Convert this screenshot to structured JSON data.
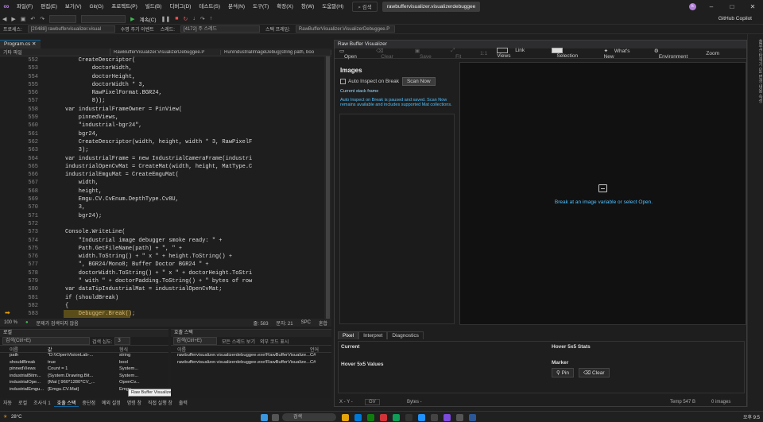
{
  "menu": [
    "파일(F)",
    "편집(E)",
    "보기(V)",
    "Git(G)",
    "프로젝트(P)",
    "빌드(B)",
    "디버그(D)",
    "테스트(S)",
    "분석(N)",
    "도구(T)",
    "확장(X)",
    "창(W)",
    "도움말(H)"
  ],
  "search_label": "검색",
  "solution_title": "rawbuffervisualizer.visualizerdebuggee",
  "avatar_letter": "k",
  "copilot_label": "GitHub Copilot",
  "continue_label": "계속(C)",
  "process_label": "프로세스:",
  "process_value": "[20488] rawbuffervisualizer.visual",
  "lifecycle_label": "수명 주기 이벤트",
  "thread_label": "스레드:",
  "thread_value": "[4172] 주 스레드",
  "stackframe_label": "스택 프레임:",
  "stackframe_value": "RawBufferVisualizer.VisualizerDebuggee.P",
  "editor": {
    "tab": "Program.cs",
    "nav": [
      "기타 파일",
      "RawBufferVisualizer.VisualizerDebuggee.P",
      "RunIndustrialImageDebug(string path, boo"
    ],
    "lines": [
      {
        "n": "552",
        "t": "    CreateDescriptor("
      },
      {
        "n": "553",
        "t": "        doctorWidth,"
      },
      {
        "n": "554",
        "t": "        doctorHeight,"
      },
      {
        "n": "555",
        "t": "        doctorWidth * 3,"
      },
      {
        "n": "556",
        "t": "        RawPixelFormat.BGR24,"
      },
      {
        "n": "557",
        "t": "        8));"
      },
      {
        "n": "558",
        "t": "var industrialFrameOwner = PinView("
      },
      {
        "n": "559",
        "t": "    pinnedViews,"
      },
      {
        "n": "560",
        "t": "    \"industrial-bgr24\","
      },
      {
        "n": "561",
        "t": "    bgr24,"
      },
      {
        "n": "562",
        "t": "    CreateDescriptor(width, height, width * 3, RawPixelF"
      },
      {
        "n": "563",
        "t": "    3);"
      },
      {
        "n": "564",
        "t": "var industrialFrame = new IndustrialCameraFrame(industri"
      },
      {
        "n": "565",
        "t": "industrialOpenCvMat = CreateMat(width, height, MatType.C"
      },
      {
        "n": "566",
        "t": "industrialEmguMat = CreateEmguMat("
      },
      {
        "n": "567",
        "t": "    width,"
      },
      {
        "n": "568",
        "t": "    height,"
      },
      {
        "n": "569",
        "t": "    Emgu.CV.CvEnum.DepthType.Cv8U,"
      },
      {
        "n": "570",
        "t": "    3,"
      },
      {
        "n": "571",
        "t": "    bgr24);"
      },
      {
        "n": "572",
        "t": ""
      },
      {
        "n": "573",
        "t": "Console.WriteLine("
      },
      {
        "n": "574",
        "t": "    \"Industrial image debugger smoke ready: \" +"
      },
      {
        "n": "575",
        "t": "    Path.GetFileName(path) + \", \" +"
      },
      {
        "n": "576",
        "t": "    width.ToString() + \" x \" + height.ToString() +"
      },
      {
        "n": "577",
        "t": "    \", BGR24/Mono8; Buffer Doctor BGR24 \" +"
      },
      {
        "n": "578",
        "t": "    doctorWidth.ToString() + \" x \" + doctorHeight.ToStri"
      },
      {
        "n": "579",
        "t": "    \" with \" + doctorPadding.ToString() + \" bytes of row"
      },
      {
        "n": "580",
        "t": "var dataTipIndustrialMat = industrialOpenCvMat;"
      },
      {
        "n": "581",
        "t": "if (shouldBreak)"
      },
      {
        "n": "582",
        "t": "{"
      },
      {
        "n": "583",
        "t": "    Debugger.Break();"
      }
    ],
    "zoom": "100 %",
    "issues": "문제가 검색되지 않음",
    "line_info": "줄: 583",
    "char_info": "문자: 21",
    "spc": "SPC",
    "crlf": "혼합"
  },
  "rbv": {
    "title": "Raw Buffer Visualizer",
    "toolbar": [
      "Open",
      "Clear",
      "Save",
      "Fit",
      "1:1",
      "Link Views",
      "Selection",
      "What's New",
      "Environment",
      "Zoom"
    ],
    "images_heading": "Images",
    "auto_inspect": "Auto Inspect on Break",
    "scan_now": "Scan Now",
    "current_frame": "Current stack frame",
    "paused_note": "Auto Inspect on Break is paused and saved. Scan Now remains available and includes supported Mat collections.",
    "viewer_hint": "Break at an image variable or select Open.",
    "tabs": [
      "Pixel",
      "Interpret",
      "Diagnostics"
    ],
    "current": "Current",
    "hover_stats": "Hover 5x5 Stats",
    "hover_values": "Hover 5x5 Values",
    "marker": "Marker",
    "pin": "Pin",
    "clear": "Clear",
    "status_xy": "X - Y -",
    "status_gv": "GV",
    "status_bytes": "Bytes -",
    "status_temp": "Temp 547 B",
    "status_images": "0 images"
  },
  "rightrail": "솔루션 탐색기   Git 변경 내용   속성",
  "locals": {
    "title": "로컬",
    "search": "검색(Ctrl+E)",
    "depth_label": "검색 심도:",
    "depth": "3",
    "headers": [
      "이름",
      "값",
      "형식"
    ],
    "rows": [
      {
        "name": "path",
        "value": "\"D:\\\\OpenVisionLab-...",
        "type": "string"
      },
      {
        "name": "shouldBreak",
        "value": "true",
        "type": "bool"
      },
      {
        "name": "pinnedViews",
        "value": "Count = 1",
        "type": "System..."
      },
      {
        "name": "industrialBitm...",
        "value": "{System.Drawing.Bit...",
        "type": "System..."
      },
      {
        "name": "industrialOpe...",
        "value": "{Mat [ 960*1280*CV_...",
        "type": "OpenCv..."
      },
      {
        "name": "industrialEmgu...",
        "value": "{Emgu.CV.Mat}",
        "type": "Emgu..."
      }
    ],
    "tooltip": "Raw Buffer Visualizer"
  },
  "callstack": {
    "title": "호출 스택",
    "search": "검색(Ctrl+E)",
    "show_all": "모든 스레드 보기",
    "external": "외부 코드 표시",
    "headers": [
      "이름",
      "언어"
    ],
    "rows": [
      {
        "name": "rawbuffervisualizer.visualizerdebuggee.exe!RawBufferVisualize...",
        "lang": "C#"
      },
      {
        "name": "rawbuffervisualizer.visualizerdebuggee.exe!RawBufferVisualize...",
        "lang": "C#"
      }
    ]
  },
  "panetabs": [
    "자동",
    "로컬",
    "조사식 1",
    "호출 스택",
    "중단점",
    "예외 설정",
    "명령 창",
    "직접 실행 창",
    "출력"
  ],
  "taskbar": {
    "weather": "28°C",
    "search": "검색",
    "time": "오후 9:5"
  }
}
